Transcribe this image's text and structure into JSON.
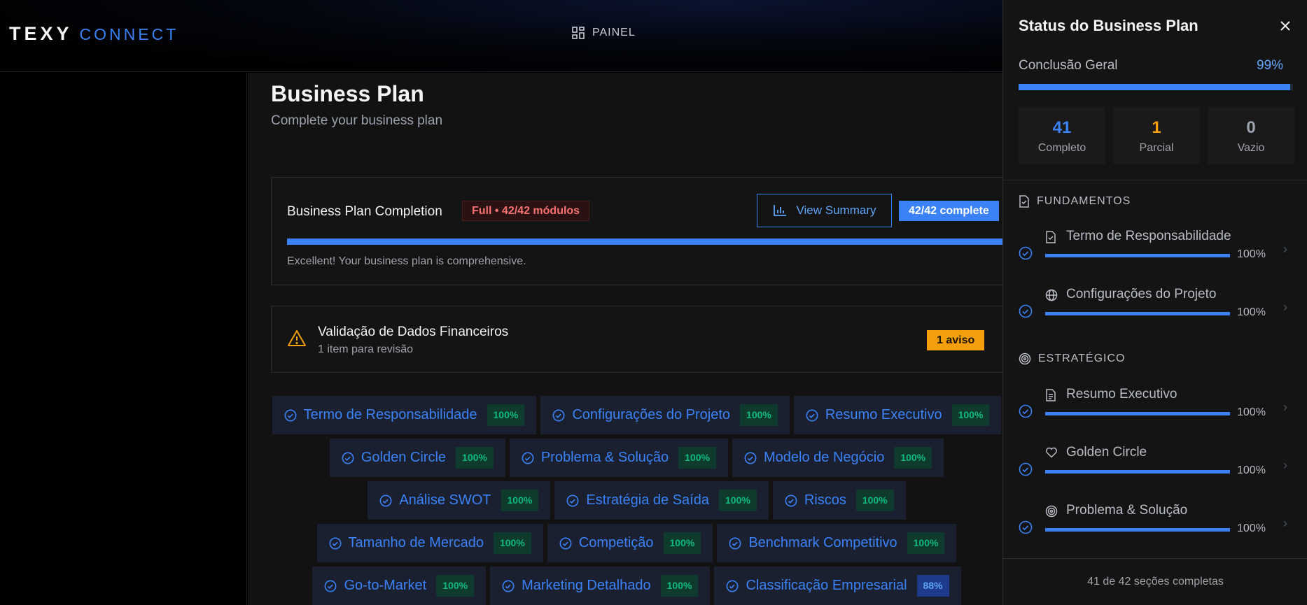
{
  "app": {
    "logo_main": "TEXY",
    "logo_sub": "CONNECT",
    "nav_label": "PAINEL"
  },
  "page": {
    "title": "Business Plan",
    "subtitle": "Complete your business plan"
  },
  "completion": {
    "title": "Business Plan Completion",
    "badge": "Full • 42/42 módulos",
    "summary_button": "View Summary",
    "complete_badge": "42/42 complete",
    "progress": 1.0,
    "message": "Excellent! Your business plan is comprehensive."
  },
  "validation": {
    "title": "Validação de Dados Financeiros",
    "subtitle": "1 item para revisão",
    "badge": "1 aviso"
  },
  "chips": [
    [
      {
        "label": "Termo de Responsabilidade",
        "pct": "100%"
      },
      {
        "label": "Configurações do Projeto",
        "pct": "100%"
      },
      {
        "label": "Resumo Executivo",
        "pct": "100%"
      }
    ],
    [
      {
        "label": "Golden Circle",
        "pct": "100%"
      },
      {
        "label": "Problema & Solução",
        "pct": "100%"
      },
      {
        "label": "Modelo de Negócio",
        "pct": "100%"
      }
    ],
    [
      {
        "label": "Análise SWOT",
        "pct": "100%"
      },
      {
        "label": "Estratégia de Saída",
        "pct": "100%"
      },
      {
        "label": "Riscos",
        "pct": "100%"
      }
    ],
    [
      {
        "label": "Tamanho de Mercado",
        "pct": "100%"
      },
      {
        "label": "Competição",
        "pct": "100%"
      },
      {
        "label": "Benchmark Competitivo",
        "pct": "100%"
      }
    ],
    [
      {
        "label": "Go-to-Market",
        "pct": "100%"
      },
      {
        "label": "Marketing Detalhado",
        "pct": "100%"
      },
      {
        "label": "Classificação Empresarial",
        "pct": "88%"
      }
    ]
  ],
  "panel": {
    "title": "Status do Business Plan",
    "overall_label": "Conclusão Geral",
    "overall_value": "99%",
    "overall_progress": 0.99,
    "stats": [
      {
        "num": "41",
        "label": "Completo",
        "color": "#3b82f6"
      },
      {
        "num": "1",
        "label": "Parcial",
        "color": "#f59e0b"
      },
      {
        "num": "0",
        "label": "Vazio",
        "color": "#9ca3af"
      }
    ],
    "section_fundamentos": "FUNDAMENTOS",
    "section_estrategico": "ESTRATÉGICO",
    "items": [
      {
        "name": "Termo de Responsabilidade",
        "pct": "100%",
        "icon": "file-check-icon"
      },
      {
        "name": "Configurações do Projeto",
        "pct": "100%",
        "icon": "globe-icon"
      },
      {
        "name": "Resumo Executivo",
        "pct": "100%",
        "icon": "document-icon"
      },
      {
        "name": "Golden Circle",
        "pct": "100%",
        "icon": "heart-icon"
      },
      {
        "name": "Problema & Solução",
        "pct": "100%",
        "icon": "target-icon"
      }
    ],
    "footer": "41 de 42 seções completas"
  },
  "colors": {
    "accent": "#3b82f6",
    "warning": "#f59e0b",
    "success": "#10b981",
    "danger": "#f87171"
  }
}
